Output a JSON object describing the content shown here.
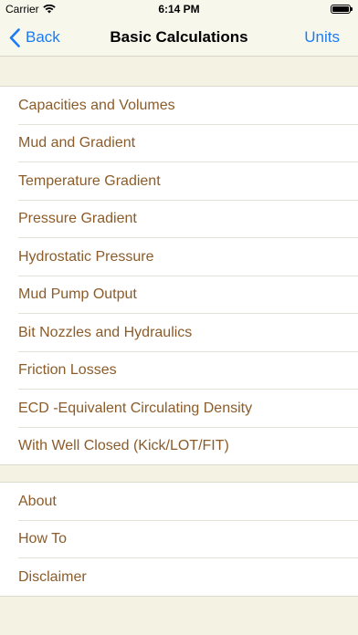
{
  "status_bar": {
    "carrier": "Carrier",
    "time": "6:14 PM"
  },
  "nav": {
    "back_label": "Back",
    "title": "Basic Calculations",
    "units_label": "Units"
  },
  "calculations": [
    "Capacities and Volumes",
    "Mud and Gradient",
    "Temperature Gradient",
    "Pressure Gradient",
    "Hydrostatic Pressure",
    "Mud Pump Output",
    "Bit Nozzles and Hydraulics",
    "Friction Losses",
    "ECD -Equivalent Circulating Density",
    "With Well Closed (Kick/LOT/FIT)"
  ],
  "info": [
    "About",
    "How To",
    "Disclaimer"
  ],
  "colors": {
    "background": "#f4f2e2",
    "row_text": "#8b5c2a",
    "accent": "#1a7cf5"
  }
}
